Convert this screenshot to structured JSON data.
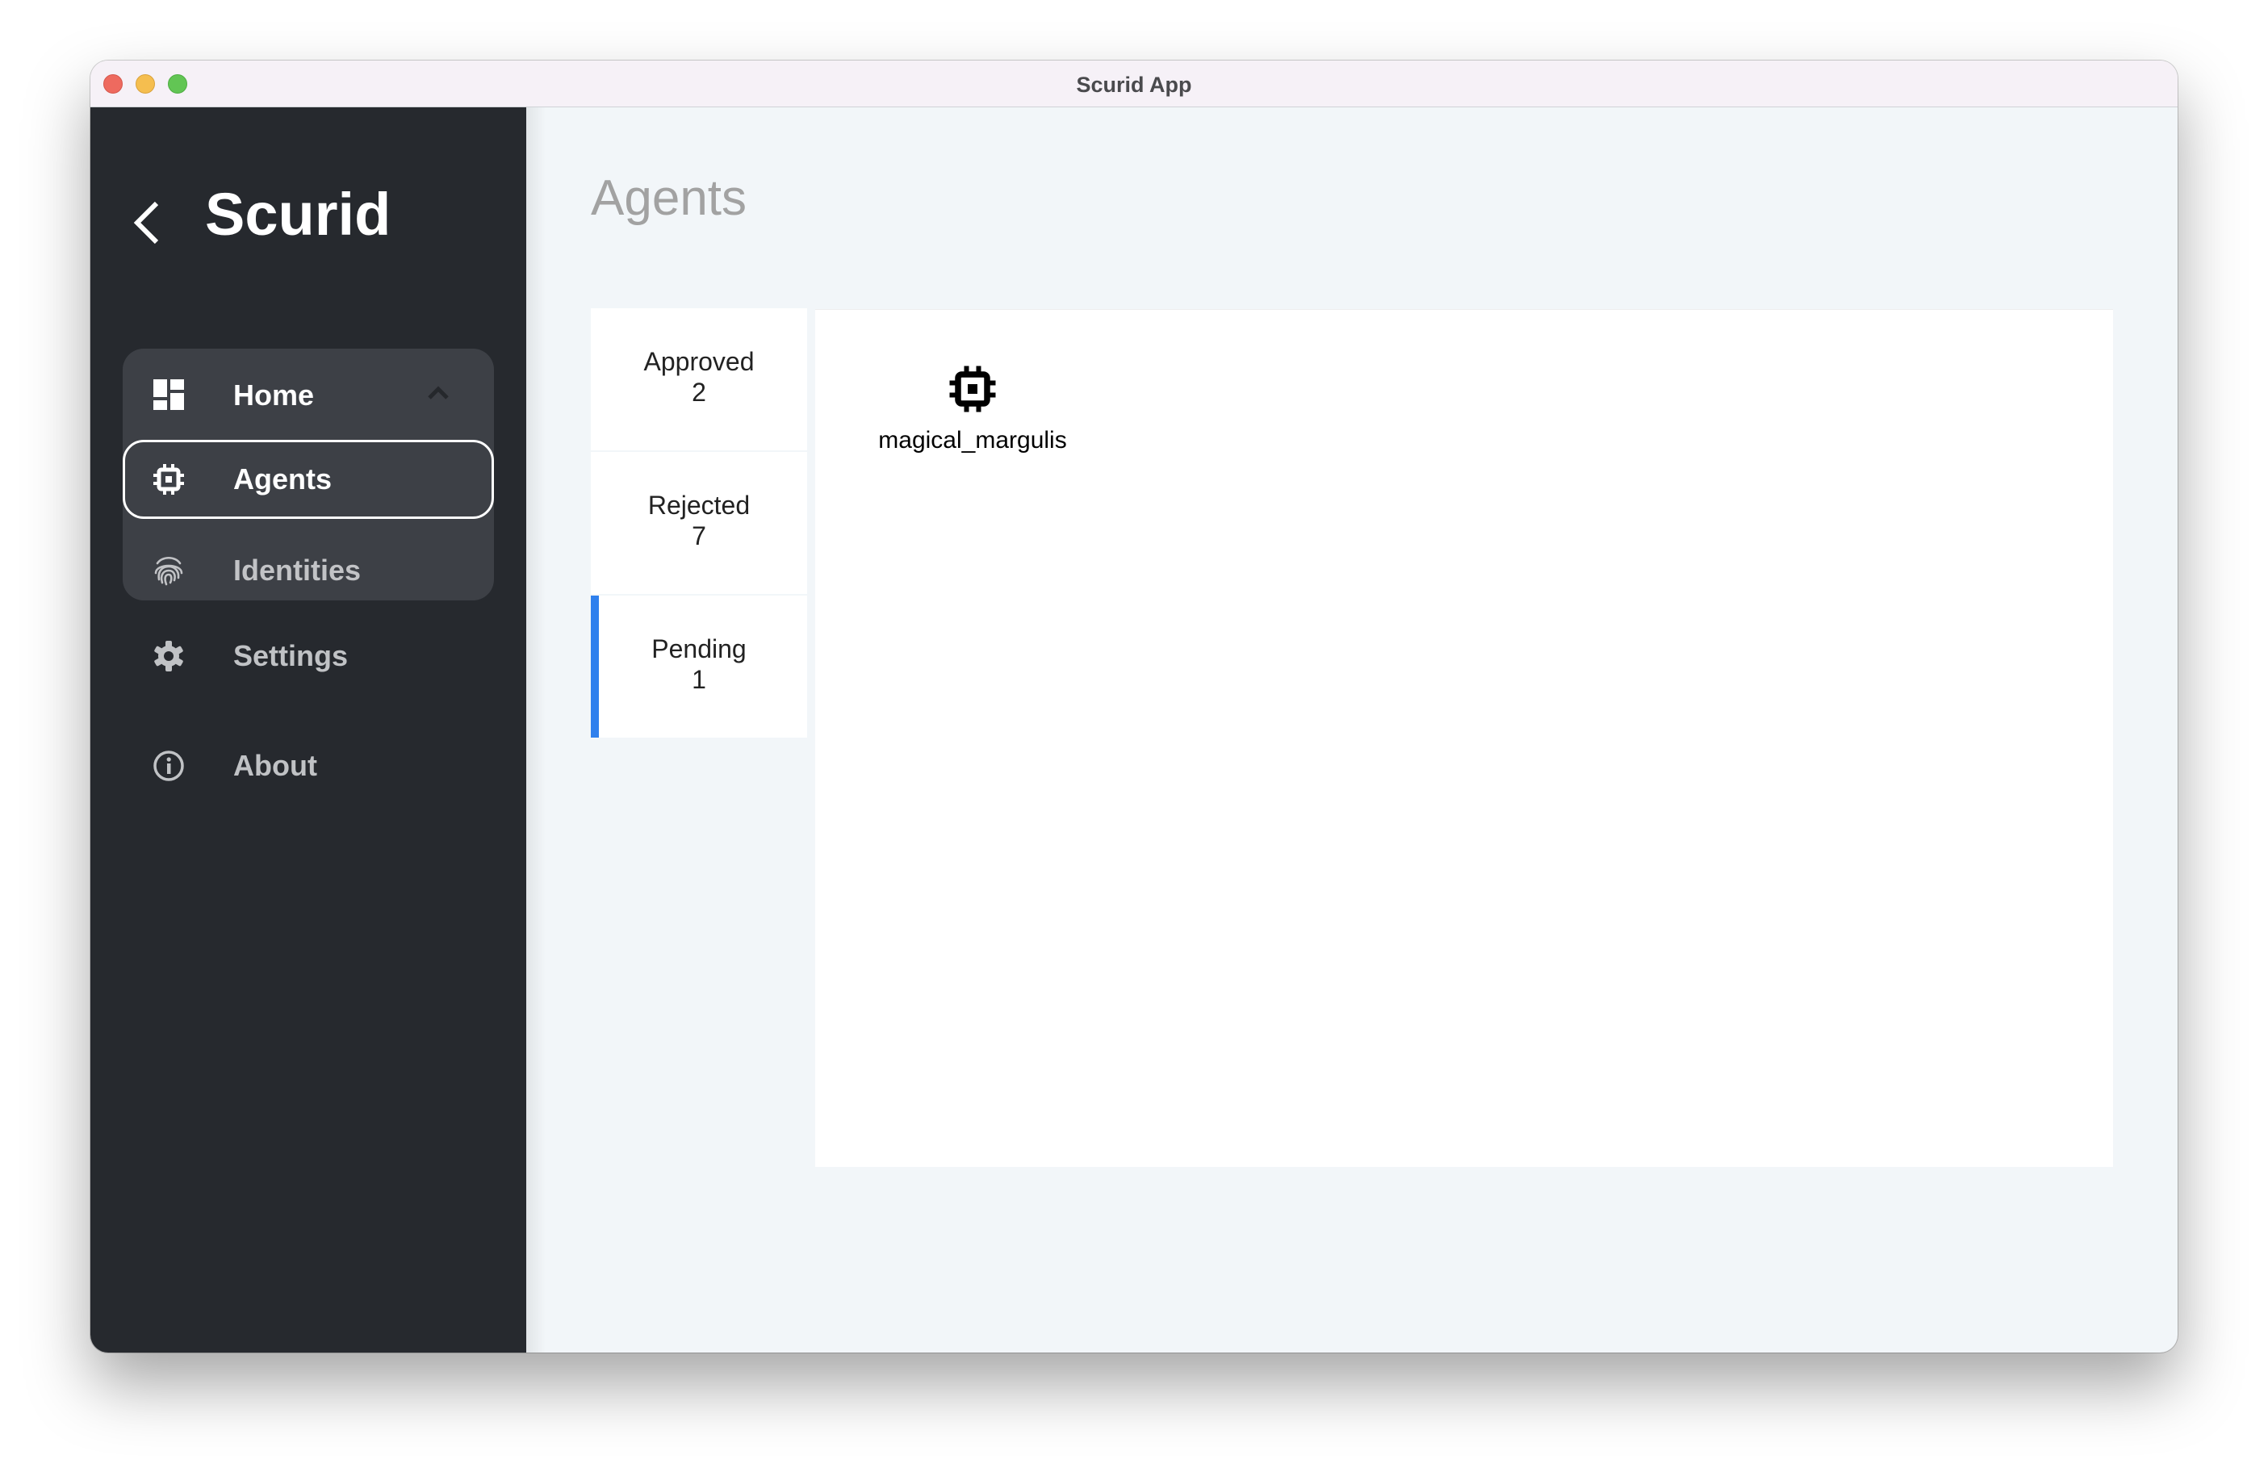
{
  "window": {
    "title": "Scurid App"
  },
  "sidebar": {
    "brand": "Scurid",
    "back_icon": "chevron-left-icon",
    "group": {
      "label": "Home",
      "icon": "dashboard-icon",
      "expanded": true,
      "toggle_icon": "chevron-up-icon",
      "items": [
        {
          "label": "Agents",
          "icon": "chip-icon",
          "selected": true
        },
        {
          "label": "Identities",
          "icon": "fingerprint-icon",
          "selected": false
        }
      ]
    },
    "items": [
      {
        "label": "Settings",
        "icon": "gear-icon"
      },
      {
        "label": "About",
        "icon": "info-icon"
      }
    ]
  },
  "main": {
    "title": "Agents",
    "tabs": [
      {
        "label": "Approved",
        "count": "2",
        "active": false
      },
      {
        "label": "Rejected",
        "count": "7",
        "active": false
      },
      {
        "label": "Pending",
        "count": "1",
        "active": true
      }
    ],
    "agents": [
      {
        "name": "magical_margulis",
        "icon": "chip-icon"
      }
    ]
  },
  "colors": {
    "sidebar_bg": "#26292e",
    "nav_group_bg": "#3d4046",
    "main_bg": "#f2f6f9",
    "active_tab_accent": "#2f80ed",
    "title_text": "#a2a2a2"
  }
}
